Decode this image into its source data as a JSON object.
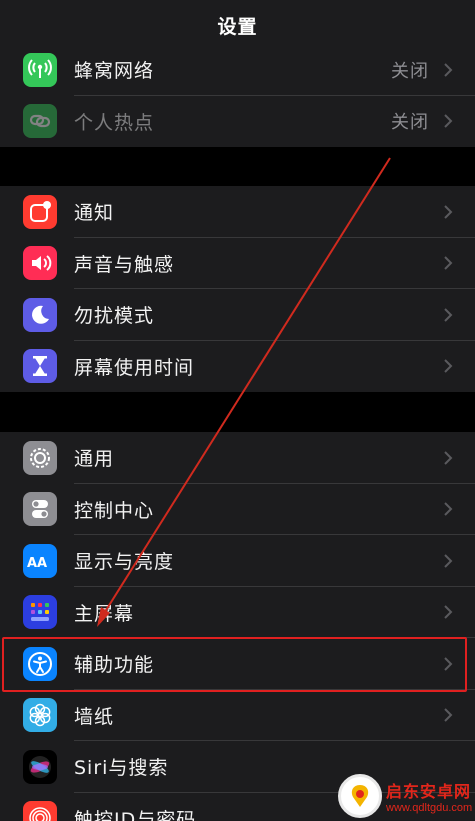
{
  "header": {
    "title": "设置"
  },
  "groups": [
    {
      "items": [
        {
          "label": "蜂窝网络",
          "value": "关闭",
          "icon": "cellular-icon",
          "color": "#34c759"
        },
        {
          "label": "个人热点",
          "value": "关闭",
          "icon": "hotspot-icon",
          "color": "#34c759",
          "dimmed": true
        }
      ]
    },
    {
      "items": [
        {
          "label": "通知",
          "icon": "notifications-icon",
          "color": "#ff3b30"
        },
        {
          "label": "声音与触感",
          "icon": "sound-icon",
          "color": "#ff2d55"
        },
        {
          "label": "勿扰模式",
          "icon": "moon-icon",
          "color": "#5e5ce6"
        },
        {
          "label": "屏幕使用时间",
          "icon": "hourglass-icon",
          "color": "#5e5ce6"
        }
      ]
    },
    {
      "items": [
        {
          "label": "通用",
          "icon": "gear-icon",
          "color": "#8e8e93"
        },
        {
          "label": "控制中心",
          "icon": "toggles-icon",
          "color": "#8e8e93"
        },
        {
          "label": "显示与亮度",
          "icon": "display-aa-icon",
          "color": "#0a84ff"
        },
        {
          "label": "主屏幕",
          "icon": "home-screen-icon",
          "color": "#2c3ee0"
        },
        {
          "label": "辅助功能",
          "icon": "accessibility-icon",
          "color": "#0a84ff"
        },
        {
          "label": "墙纸",
          "icon": "wallpaper-flower-icon",
          "color": "#32ade6"
        },
        {
          "label": "Siri与搜索",
          "icon": "siri-icon",
          "color": "#1c1c1e"
        },
        {
          "label": "触控ID与密码",
          "icon": "fingerprint-icon",
          "color": "#ff3b30"
        }
      ]
    }
  ],
  "annotation": {
    "highlighted_item": "辅助功能",
    "color": "#e02020"
  },
  "watermark": {
    "line1": "启东安卓网",
    "line2": "www.qdltgdu.com"
  }
}
